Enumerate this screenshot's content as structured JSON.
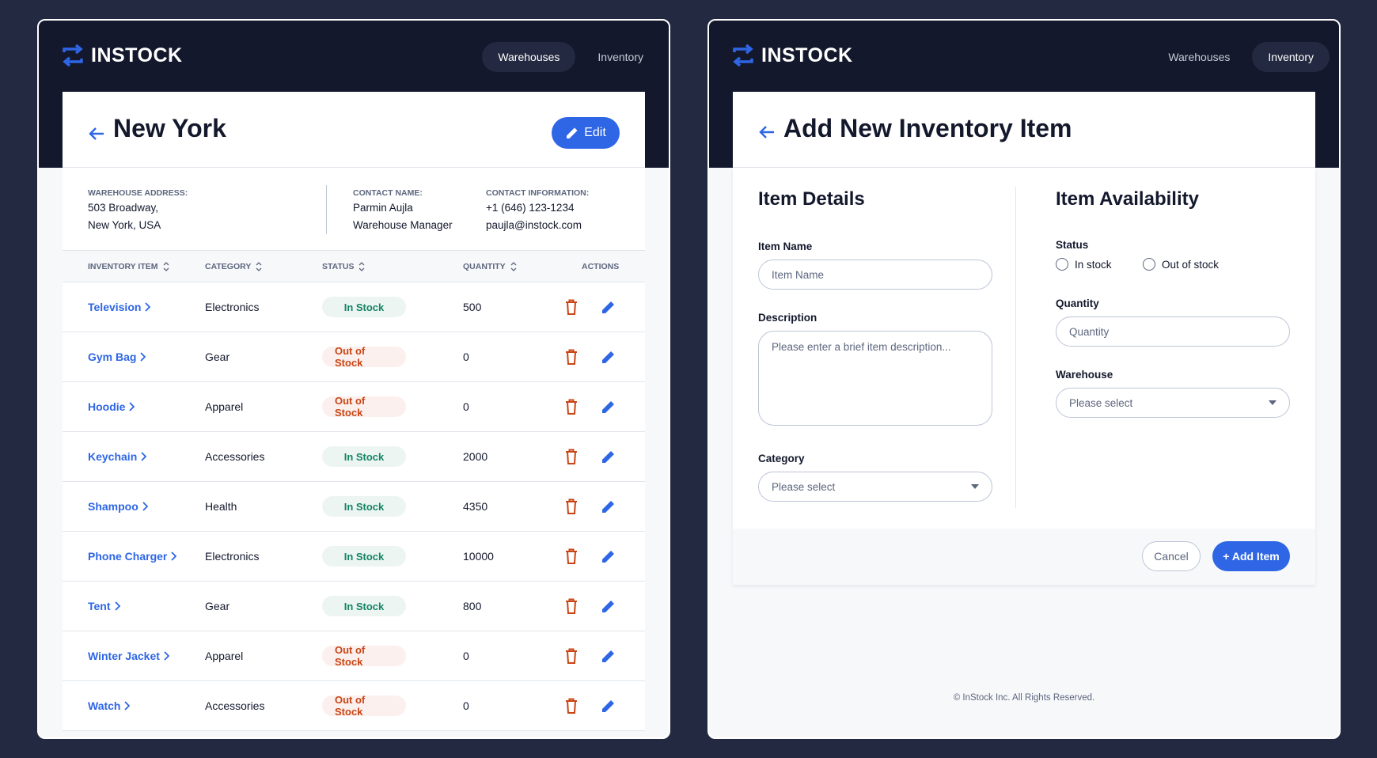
{
  "brand": {
    "name": "INSTOCK"
  },
  "nav": {
    "warehouses": "Warehouses",
    "inventory": "Inventory"
  },
  "warehouse_detail": {
    "title": "New York",
    "edit_label": "Edit",
    "address_label": "WAREHOUSE ADDRESS:",
    "address_line1": "503 Broadway,",
    "address_line2": "New York, USA",
    "contact_name_label": "CONTACT NAME:",
    "contact_name": "Parmin Aujla",
    "contact_title": "Warehouse Manager",
    "contact_info_label": "CONTACT INFORMATION:",
    "contact_phone": "+1 (646) 123-1234",
    "contact_email": "paujla@instock.com",
    "columns": {
      "item": "INVENTORY ITEM",
      "category": "CATEGORY",
      "status": "STATUS",
      "quantity": "QUANTITY",
      "actions": "ACTIONS"
    },
    "rows": [
      {
        "name": "Television",
        "category": "Electronics",
        "status": "In Stock",
        "in_stock": true,
        "quantity": "500"
      },
      {
        "name": "Gym Bag",
        "category": "Gear",
        "status": "Out of Stock",
        "in_stock": false,
        "quantity": "0"
      },
      {
        "name": "Hoodie",
        "category": "Apparel",
        "status": "Out of Stock",
        "in_stock": false,
        "quantity": "0"
      },
      {
        "name": "Keychain",
        "category": "Accessories",
        "status": "In Stock",
        "in_stock": true,
        "quantity": "2000"
      },
      {
        "name": "Shampoo",
        "category": "Health",
        "status": "In Stock",
        "in_stock": true,
        "quantity": "4350"
      },
      {
        "name": "Phone Charger",
        "category": "Electronics",
        "status": "In Stock",
        "in_stock": true,
        "quantity": "10000"
      },
      {
        "name": "Tent",
        "category": "Gear",
        "status": "In Stock",
        "in_stock": true,
        "quantity": "800"
      },
      {
        "name": "Winter Jacket",
        "category": "Apparel",
        "status": "Out of Stock",
        "in_stock": false,
        "quantity": "0"
      },
      {
        "name": "Watch",
        "category": "Accessories",
        "status": "Out of Stock",
        "in_stock": false,
        "quantity": "0"
      }
    ]
  },
  "add_item": {
    "title": "Add New Inventory Item",
    "details_title": "Item Details",
    "item_name_label": "Item Name",
    "item_name_placeholder": "Item Name",
    "description_label": "Description",
    "description_placeholder": "Please enter a brief item description...",
    "category_label": "Category",
    "category_value": "Please select",
    "availability_title": "Item Availability",
    "status_label": "Status",
    "in_stock_label": "In stock",
    "out_of_stock_label": "Out of stock",
    "quantity_label": "Quantity",
    "quantity_placeholder": "Quantity",
    "warehouse_label": "Warehouse",
    "warehouse_value": "Please select",
    "cancel_label": "Cancel",
    "add_label": "+ Add Item"
  },
  "footer": {
    "copyright": "© InStock Inc. All Rights Reserved."
  },
  "colors": {
    "navy": "#13182c",
    "background": "#232940",
    "accent": "#2e66e5",
    "in_stock": "#158463",
    "out_of_stock": "#c94515"
  },
  "icons": {
    "logo": "swap-arrows-icon",
    "back": "arrow-back-icon",
    "edit": "pencil-icon",
    "delete": "trash-icon",
    "chevron": "chevron-right-icon",
    "sort": "sort-icon",
    "dropdown": "caret-down-icon"
  }
}
